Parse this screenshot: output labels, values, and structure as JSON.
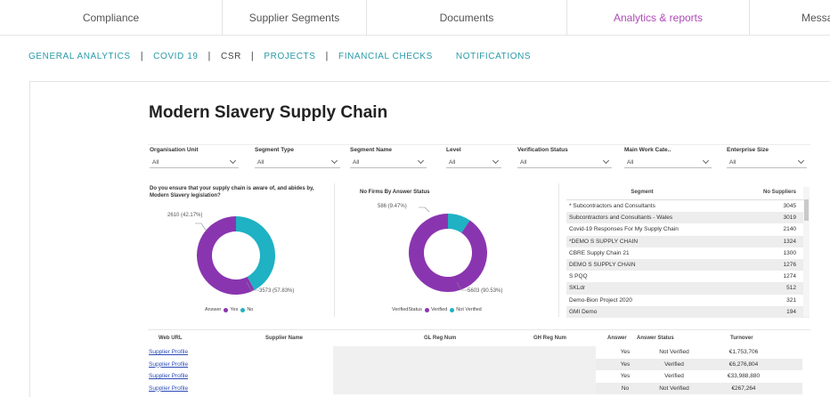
{
  "top_nav": {
    "tabs": [
      {
        "label": "Compliance",
        "active": false
      },
      {
        "label": "Supplier Segments",
        "active": false
      },
      {
        "label": "Documents",
        "active": false
      },
      {
        "label": "Analytics & reports",
        "active": true
      },
      {
        "label": "Messa",
        "active": false
      }
    ]
  },
  "sub_nav": {
    "items": [
      {
        "label": "GENERAL ANALYTICS",
        "active": false
      },
      {
        "label": "COVID 19",
        "active": false
      },
      {
        "label": "CSR",
        "active": true
      },
      {
        "label": "PROJECTS",
        "active": false
      },
      {
        "label": "FINANCIAL CHECKS",
        "active": false
      },
      {
        "label": "NOTIFICATIONS",
        "active": false
      }
    ],
    "separator": "|"
  },
  "report": {
    "title": "Modern Slavery Supply Chain"
  },
  "filters": [
    {
      "label": "Organisation Unit",
      "value": "All"
    },
    {
      "label": "Segment Type",
      "value": "All"
    },
    {
      "label": "Segment Name",
      "value": "All"
    },
    {
      "label": "Level",
      "value": "All"
    },
    {
      "label": "Verification Status",
      "value": "All"
    },
    {
      "label": "Main Work Cate..",
      "value": "All"
    },
    {
      "label": "Enterprise Size",
      "value": "All"
    }
  ],
  "colors": {
    "yes": "#8a35b0",
    "no": "#1fb1c4",
    "accent_tab": "#b04ab8",
    "subnav": "#2a9aa8",
    "link": "#2b4bb5"
  },
  "donut_left": {
    "question": "Do you ensure that your supply chain is aware of, and abides by, Modern Slavery legislation?",
    "slices": [
      {
        "name": "Yes",
        "value": 3573,
        "pct": "57.83%",
        "label": "3573 (57.83%)"
      },
      {
        "name": "No",
        "value": 2610,
        "pct": "42.17%",
        "label": "2610 (42.17%)"
      }
    ],
    "legend_title": "Answer",
    "legend": [
      "Yes",
      "No"
    ]
  },
  "donut_right": {
    "question": "No Firms By Answer Status",
    "slices": [
      {
        "name": "Verified",
        "value": 5603,
        "pct": "90.53%",
        "label": "5603 (90.53%)"
      },
      {
        "name": "Not Verified",
        "value": 586,
        "pct": "9.47%",
        "label": "586 (9.47%)"
      }
    ],
    "legend_title": "VerifiedStatus",
    "legend": [
      "Verified",
      "Not Verified"
    ]
  },
  "segment_table": {
    "headers": [
      "Segment",
      "No Suppliers"
    ],
    "rows": [
      {
        "segment": "* Subcontractors and Consultants",
        "count": "3045"
      },
      {
        "segment": "Subcontractors and Consultants - Wales",
        "count": "3019"
      },
      {
        "segment": "Covid-19 Responses For My Supply Chain",
        "count": "2140"
      },
      {
        "segment": "*DEMO S SUPPLY CHAIN",
        "count": "1324"
      },
      {
        "segment": "CBRE Supply Chain 21",
        "count": "1300"
      },
      {
        "segment": "DEMO S SUPPLY CHAIN",
        "count": "1276"
      },
      {
        "segment": "S PQQ",
        "count": "1274"
      },
      {
        "segment": "SKLdr",
        "count": "512"
      },
      {
        "segment": "Demo-Bion Project 2020",
        "count": "321"
      },
      {
        "segment": "GMI Demo",
        "count": "194"
      }
    ]
  },
  "supplier_table": {
    "headers": [
      "Web URL",
      "Supplier Name",
      "GL Reg Num",
      "GH Reg Num",
      "Answer",
      "Answer Status",
      "Turnover"
    ],
    "rows": [
      {
        "link": "Supplier Profile",
        "answer": "Yes",
        "status": "Not Verified",
        "turnover": "€1,753,706"
      },
      {
        "link": "Supplier Profile",
        "answer": "Yes",
        "status": "Verified",
        "turnover": "€6,276,804"
      },
      {
        "link": "Supplier Profile",
        "answer": "Yes",
        "status": "Verified",
        "turnover": "€33,988,880"
      },
      {
        "link": "Supplier Profile",
        "answer": "No",
        "status": "Not Verified",
        "turnover": "€267,264"
      }
    ]
  }
}
